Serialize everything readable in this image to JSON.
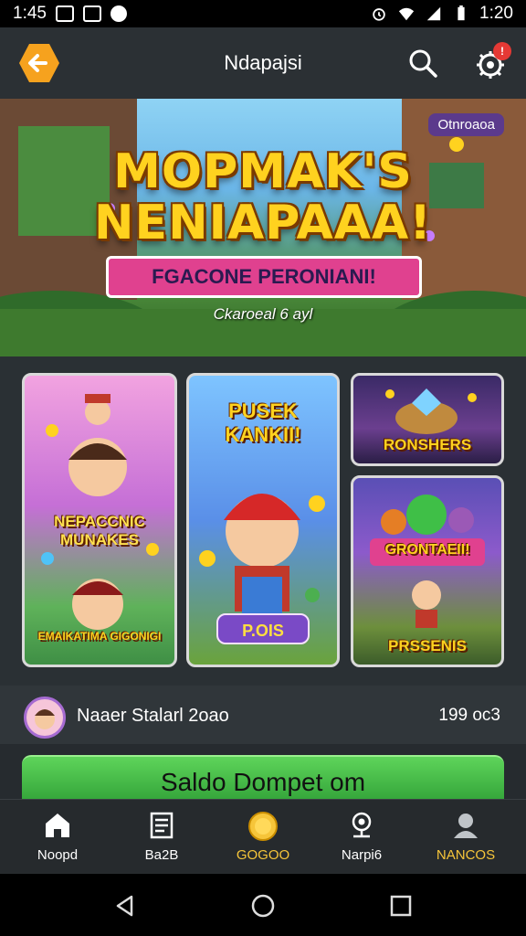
{
  "status_bar": {
    "time": "1:45",
    "right_time": "1:20"
  },
  "header": {
    "title": "Ndapajsi",
    "back_icon": "arrow-left-icon",
    "search_icon": "search-icon",
    "notification_icon": "gear-bell-icon",
    "notification_badge": "!"
  },
  "banner": {
    "tag": "Otnroaoa",
    "title_line1": "MOPMAK'S",
    "title_line2": "NENIAPAAA!",
    "ribbon": "FGACONE PERONIANI!",
    "date": "Ckaroeal 6 ayl"
  },
  "cards": [
    {
      "label": "NEPACCNIC MUNAKES",
      "sublabel": "EMAIKATIMA GIGONIGI"
    },
    {
      "label": "PUSEK KANKII!",
      "button": "P.OIS"
    },
    {
      "label": "RONSHERS"
    },
    {
      "label": "GRONTAEII!",
      "button": "PRSSENIS"
    }
  ],
  "wallet": {
    "name": "Naaer Stalarl 2oao",
    "amount": "199 oc3"
  },
  "cta": {
    "label": "Saldo Dompet om"
  },
  "bottom_nav": [
    {
      "label": "Noopd",
      "icon": "home-icon"
    },
    {
      "label": "Ba2B",
      "icon": "receipt-icon"
    },
    {
      "label": "GOGOO",
      "icon": "coin-icon"
    },
    {
      "label": "Narpi6",
      "icon": "location-icon"
    },
    {
      "label": "NANCOS",
      "icon": "profile-icon"
    }
  ],
  "colors": {
    "accent": "#f6a21e",
    "cta_green": "#3fbf47",
    "gold_text": "#f6c53a",
    "badge_red": "#e53935"
  }
}
